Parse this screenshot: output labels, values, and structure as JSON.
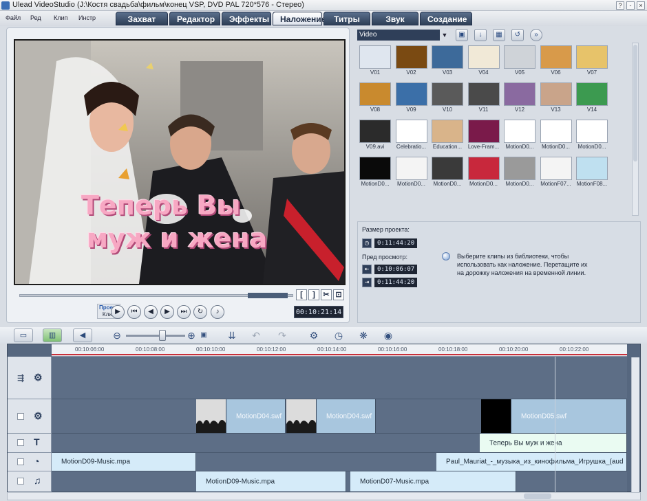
{
  "window": {
    "title": "Ulead VideoStudio (J:\\Костя свадьба\\фильм\\конец VSP, DVD PAL 720*576 - Стерео)",
    "buttons": [
      "?",
      "-",
      "×"
    ]
  },
  "menu": [
    "Файл",
    "Ред",
    "Клип",
    "Инстр"
  ],
  "steps": [
    "Захват",
    "Редактор",
    "Эффекты",
    "Наложение",
    "Титры",
    "Звук",
    "Создание"
  ],
  "active_step": "Наложение",
  "preview": {
    "overlay_line1": "Теперь Вы",
    "overlay_line2": "муж и жена",
    "mode_project": "Проект",
    "mode_clip": "Клип",
    "timecode": "00:10:21:14",
    "trim_start": "[",
    "trim_end": "]"
  },
  "library": {
    "category": "Video",
    "items": [
      {
        "label": "V01",
        "color": "#dfe6ef"
      },
      {
        "label": "V02",
        "color": "#7a4a12"
      },
      {
        "label": "V03",
        "color": "#3d6a9a"
      },
      {
        "label": "V04",
        "color": "#f1e9d7"
      },
      {
        "label": "V05",
        "color": "#cfd3d8"
      },
      {
        "label": "V06",
        "color": "#d89a4a"
      },
      {
        "label": "V07",
        "color": "#e7c36a"
      },
      {
        "label": "V08",
        "color": "#c98a2e"
      },
      {
        "label": "V09",
        "color": "#3b6fa8"
      },
      {
        "label": "V10",
        "color": "#5a5a5a"
      },
      {
        "label": "V11",
        "color": "#4a4a4a"
      },
      {
        "label": "V12",
        "color": "#8a6aa0"
      },
      {
        "label": "V13",
        "color": "#c9a48a"
      },
      {
        "label": "V14",
        "color": "#3c9a50"
      },
      {
        "label": "V09.avi",
        "color": "#2b2b2b"
      },
      {
        "label": "Celebratio...",
        "color": "#ffffff"
      },
      {
        "label": "Education...",
        "color": "#d9b48a"
      },
      {
        "label": "Love-Fram...",
        "color": "#7a1a4a"
      },
      {
        "label": "MotionD0...",
        "color": "#ffffff"
      },
      {
        "label": "MotionD0...",
        "color": "#ffffff"
      },
      {
        "label": "MotionD0...",
        "color": "#ffffff"
      },
      {
        "label": "MotionD0...",
        "color": "#0a0a0a"
      },
      {
        "label": "MotionD0...",
        "color": "#f4f4f4"
      },
      {
        "label": "MotionD0...",
        "color": "#3a3a3a"
      },
      {
        "label": "MotionD0...",
        "color": "#c8283c"
      },
      {
        "label": "MotionD0...",
        "color": "#9a9a9a"
      },
      {
        "label": "MotionF07...",
        "color": "#f4f4f4"
      },
      {
        "label": "MotionF08...",
        "color": "#bfe0f0"
      }
    ]
  },
  "info": {
    "project_size_label": "Размер проекта:",
    "project_size": "0:11:44:20",
    "preview_label": "Пред просмотр:",
    "preview_start": "0:10:06:07",
    "preview_end": "0:11:44:20",
    "hint": "Выберите клипы из библиотеки, чтобы использовать как наложение. Перетащите их на дорожку наложения на временной линии."
  },
  "timeline": {
    "ruler": [
      "00:10:06:00",
      "00:10:08:00",
      "00:10:10:00",
      "00:10:12:00",
      "00:10:14:00",
      "00:10:16:00",
      "00:10:18:00",
      "00:10:20:00",
      "00:10:22:00"
    ],
    "overlay_clips": [
      "MotionD04.swf",
      "MotionD04.swf",
      "MotionD05.swf"
    ],
    "title_clip": "Теперь Вы муж и жена",
    "voice_clips": [
      "MotionD09-Music.mpa",
      "Paul_Mauriat_-_музыка_из_кинофильма_Игрушка_(aud"
    ],
    "music_clips": [
      "MotionD09-Music.mpa",
      "MotionD07-Music.mpa"
    ]
  }
}
